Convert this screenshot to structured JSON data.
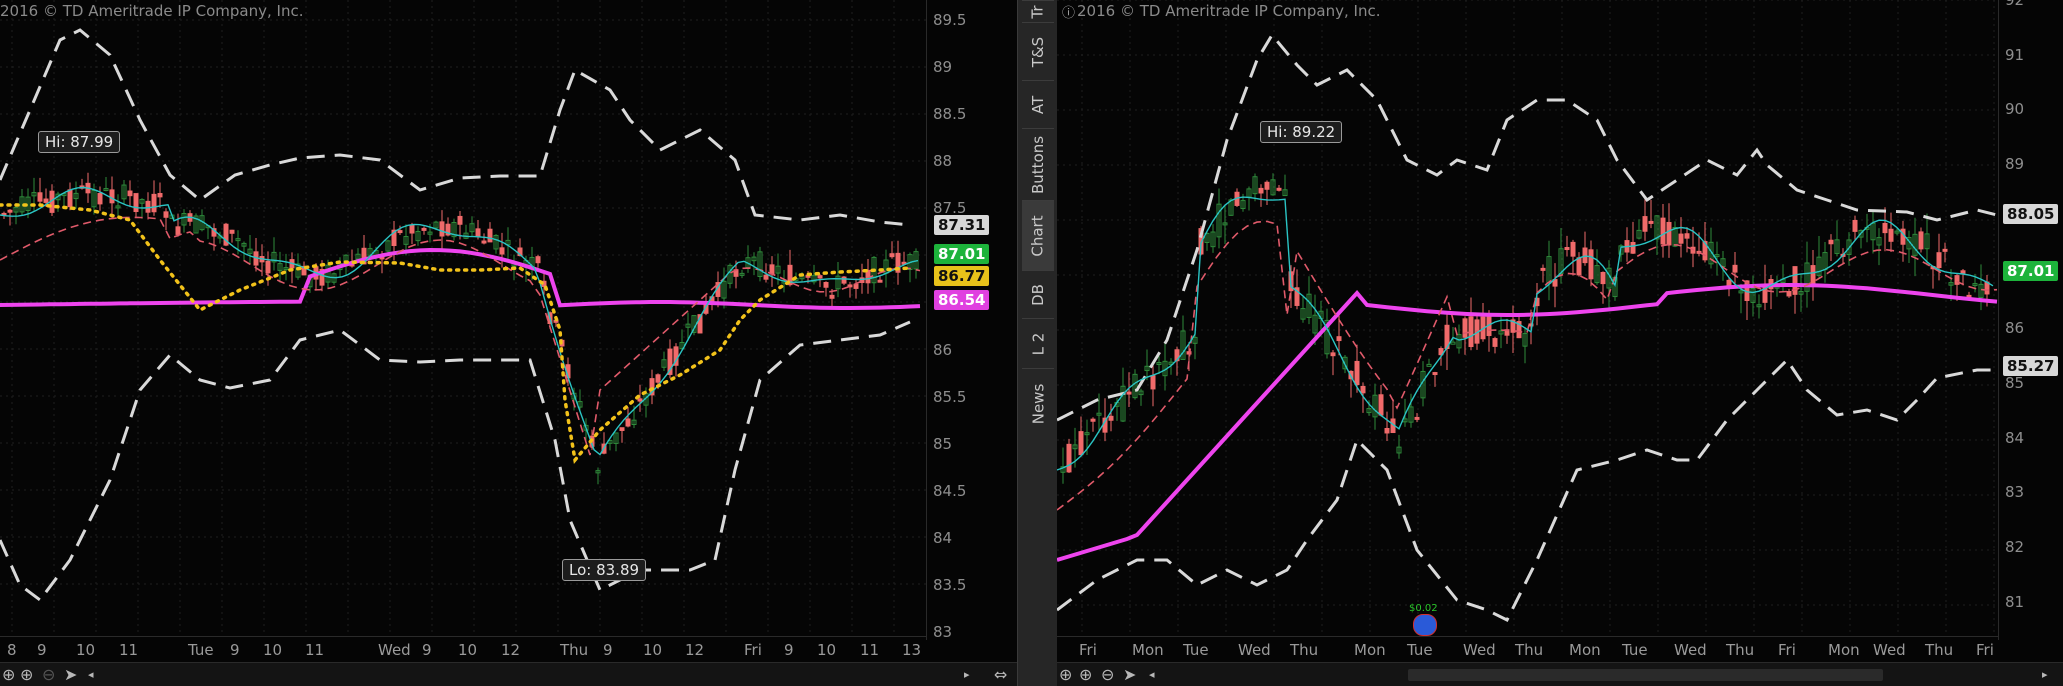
{
  "left_chart": {
    "copyright": "2016 © TD Ameritrade IP Company, Inc.",
    "hi_label": "Hi: 87.99",
    "lo_label": "Lo: 83.89",
    "price_ticks": [
      "89.5",
      "89",
      "88.5",
      "88",
      "87.5",
      "87",
      "86.5",
      "86",
      "85.5",
      "85",
      "84.5",
      "84",
      "83.5",
      "83"
    ],
    "time_labels": [
      "8",
      "9",
      "10",
      "11",
      "Tue",
      "9",
      "10",
      "11",
      "Wed",
      "9",
      "10",
      "12",
      "Thu",
      "9",
      "10",
      "12",
      "Fri",
      "9",
      "10",
      "11",
      "13"
    ],
    "price_boxes": [
      {
        "value": "87.31",
        "bg": "#d8d8d8",
        "fg": "#111111"
      },
      {
        "value": "87.01",
        "bg": "#1db33b",
        "fg": "#ffffff"
      },
      {
        "value": "86.77",
        "bg": "#e8c21a",
        "fg": "#111111"
      },
      {
        "value": "86.54",
        "bg": "#e040e0",
        "fg": "#ffffff"
      }
    ]
  },
  "right_chart": {
    "copyright": "2016 © TD Ameritrade IP Company, Inc.",
    "info_icon": "info-icon",
    "hi_label": "Hi: 89.22",
    "dividend_label": "$0.02",
    "price_ticks": [
      "92",
      "91",
      "90",
      "89",
      "88",
      "87",
      "86",
      "85",
      "84",
      "83",
      "82",
      "81"
    ],
    "time_labels": [
      "Fri",
      "Mon",
      "Tue",
      "Wed",
      "Thu",
      "Mon",
      "Tue",
      "Wed",
      "Thu",
      "Mon",
      "Tue",
      "Wed",
      "Thu",
      "Fri",
      "Mon",
      "Wed",
      "Thu",
      "Fri"
    ],
    "price_boxes": [
      {
        "value": "88.05",
        "bg": "#d8d8d8",
        "fg": "#111111"
      },
      {
        "value": "87.01",
        "bg": "#1db33b",
        "fg": "#ffffff"
      },
      {
        "value": "85.27",
        "bg": "#d8d8d8",
        "fg": "#111111"
      }
    ]
  },
  "side_tabs": [
    "Tr",
    "T&S",
    "AT",
    "Buttons",
    "Chart",
    "DB",
    "L 2",
    "News"
  ],
  "active_tab": "Chart",
  "colors": {
    "bollinger": "#d9d9d9",
    "sma_long": "#ee44ee",
    "ema_short": "#2ac4c4",
    "sma_mid": "#e05a6a",
    "dotted": "#f2c21a",
    "candle_up": "#2e8a3a",
    "candle_down": "#f06a6a"
  },
  "toolbar_icons": [
    "crosshair-icon",
    "zoom-in-icon",
    "zoom-out-icon",
    "pointer-icon"
  ]
}
